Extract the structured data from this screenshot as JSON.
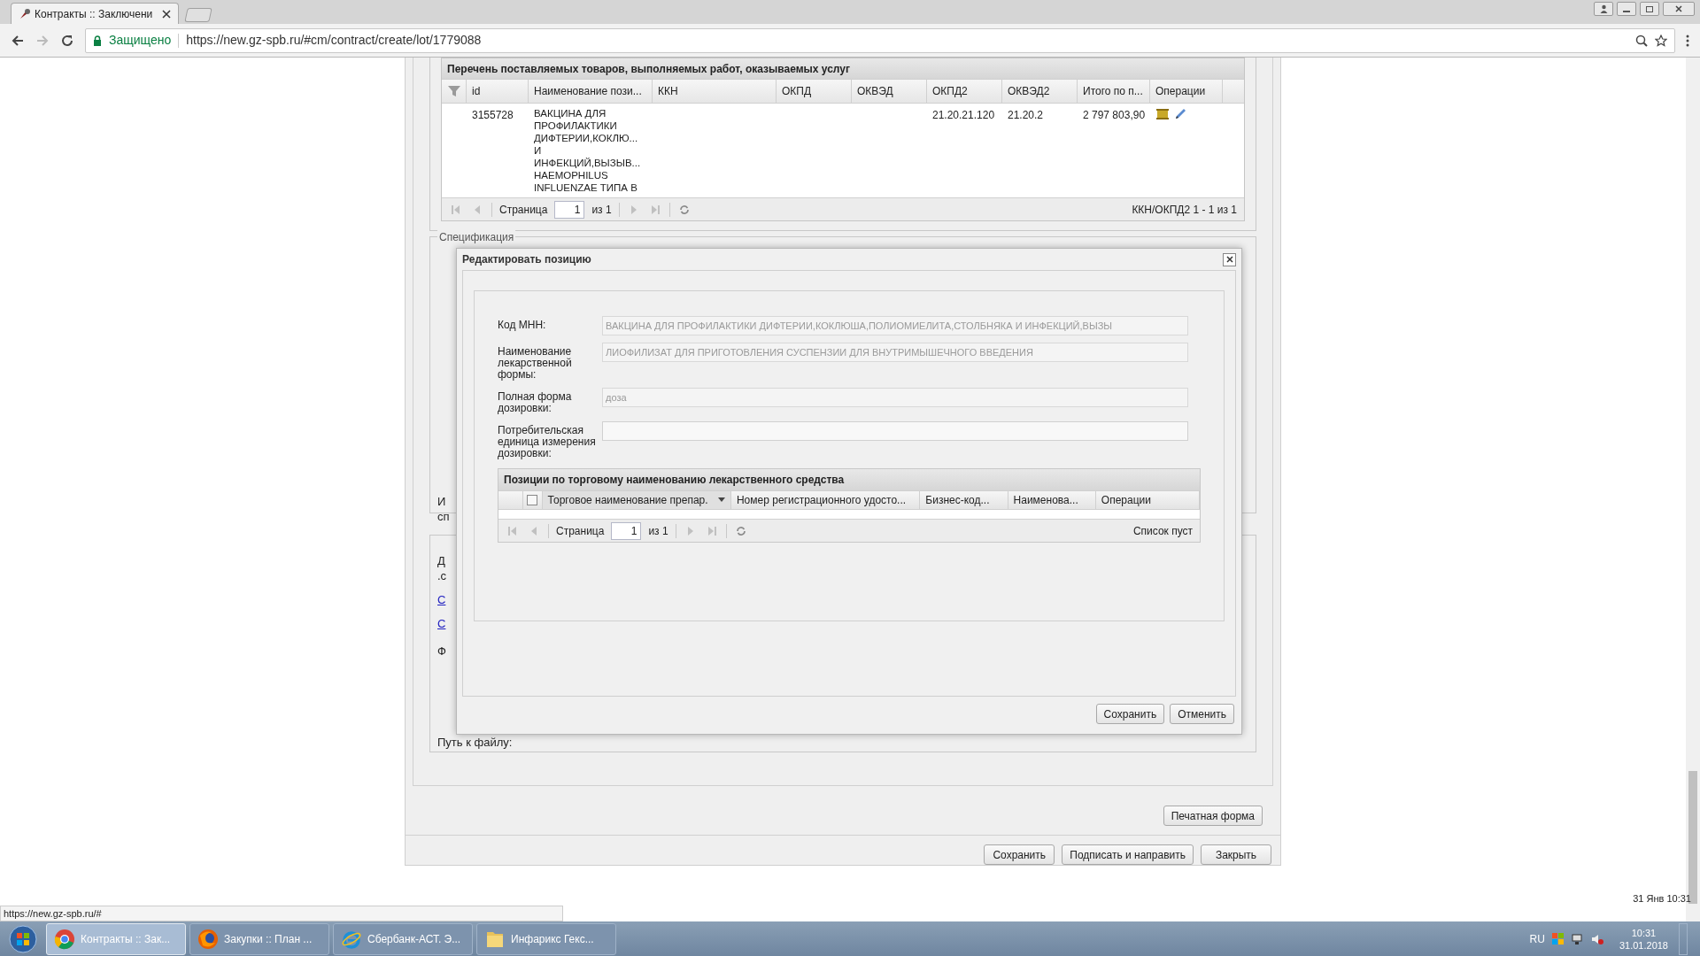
{
  "browser": {
    "tab_title": "Контракты :: Заключени",
    "security": "Защищено",
    "url": "https://new.gz-spb.ru/#cm/contract/create/lot/1779088",
    "status_url": "https://new.gz-spb.ru/#",
    "status_time": "31 Янв 10:31"
  },
  "items_section": {
    "title": "Перечень поставляемых товаров, выполняемых работ, оказываемых услуг",
    "columns": [
      "id",
      "Наименование пози...",
      "ККН",
      "ОКПД",
      "ОКВЭД",
      "ОКПД2",
      "ОКВЭД2",
      "Итого по п...",
      "Операции"
    ],
    "rows": [
      {
        "id": "3155728",
        "name": "ВАКЦИНА ДЛЯ\nПРОФИЛАКТИКИ\nДИФТЕРИИ,КОКЛЮ...\nИ\nИНФЕКЦИЙ,ВЫЗЫВ...\nHAEMOPHILUS\nINFLUENZAE ТИПА B",
        "okpd2": "21.20.21.120",
        "okved2": "21.20.2",
        "total": "2 797 803,90"
      }
    ],
    "pager": {
      "label": "Страница",
      "page": "1",
      "of": "из 1",
      "summary": "ККН/ОКПД2 1 - 1 из 1"
    }
  },
  "background": {
    "spec_legend": "Спецификация",
    "fragments": [
      "И",
      "сп",
      "Д",
      ".с",
      "Ф",
      "Путь к файлу:"
    ],
    "links": [
      "С",
      "С"
    ]
  },
  "dialog": {
    "title": "Редактировать позицию",
    "fields": [
      {
        "label": "Код МНН:",
        "value": "ВАКЦИНА ДЛЯ ПРОФИЛАКТИКИ ДИФТЕРИИ,КОКЛЮША,ПОЛИОМИЕЛИТА,СТОЛБНЯКА И ИНФЕКЦИЙ,ВЫЗЫ"
      },
      {
        "label": "Наименование лекарственной формы:",
        "value": "ЛИОФИЛИЗАТ ДЛЯ ПРИГОТОВЛЕНИЯ СУСПЕНЗИИ ДЛЯ ВНУТРИМЫШЕЧНОГО ВВЕДЕНИЯ"
      },
      {
        "label": "Полная форма дозировки:",
        "value": "доза"
      },
      {
        "label": "Потребительская единица измерения дозировки:"
      }
    ],
    "grid": {
      "title": "Позиции по торговому наименованию лекарственного средства",
      "select_all_checked": false,
      "columns": [
        "Торговое наименование препар.",
        "Номер регистрационного удосто...",
        "Бизнес-код...",
        "Наименова...",
        "Операции"
      ],
      "pager": {
        "label": "Страница",
        "page": "1",
        "of": "из 1",
        "summary": "Список пуст"
      }
    },
    "buttons": [
      "Сохранить",
      "Отменить"
    ]
  },
  "print_button": "Печатная форма",
  "footer_buttons": [
    "Сохранить",
    "Подписать и направить",
    "Закрыть"
  ],
  "taskbar": {
    "items": [
      {
        "kind": "chrome",
        "label": "Контракты :: Зак...",
        "selected": true
      },
      {
        "kind": "firefox",
        "label": "Закупки :: План ...",
        "selected": false
      },
      {
        "kind": "ie",
        "label": "Сбербанк-АСТ. Э...",
        "selected": false
      },
      {
        "kind": "folder",
        "label": "Инфарикс Гекс...",
        "selected": false
      }
    ],
    "lang": "RU",
    "time": "10:31",
    "date": "31.01.2018"
  }
}
